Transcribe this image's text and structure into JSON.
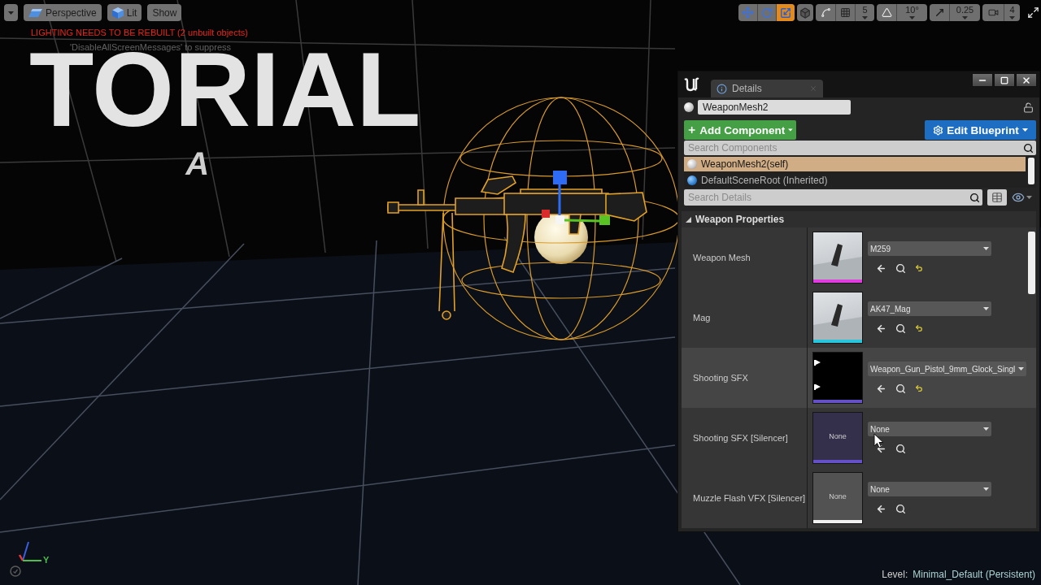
{
  "viewport": {
    "view_buttons": [
      "Perspective",
      "Lit",
      "Show"
    ],
    "warning": "LIGHTING NEEDS TO BE REBUILT (2 unbuilt objects)",
    "hint": "'DisableAllScreenMessages' to suppress",
    "scene_texts": [
      "TORIAL",
      "A"
    ],
    "transform_tools": [
      {
        "selected": false
      },
      {
        "selected": false
      },
      {
        "selected": true
      }
    ],
    "grid_snap": "5",
    "rotation_snap": "10°",
    "scale_snap": "0.25",
    "camera_speed": "4",
    "axis_label": "Y",
    "level_label": "Level:",
    "level_name": "Minimal_Default (Persistent)"
  },
  "details": {
    "tab": "Details",
    "actor_name": "WeaponMesh2",
    "add_component": "Add Component",
    "edit_blueprint": "Edit Blueprint",
    "search_components": {
      "placeholder": "Search Components"
    },
    "components": [
      {
        "label": "WeaponMesh2(self)",
        "selected": true
      },
      {
        "label": "DefaultSceneRoot (Inherited)",
        "selected": false
      }
    ],
    "search_details": {
      "placeholder": "Search Details"
    },
    "category": {
      "label": "Weapon Properties",
      "expanded": true
    },
    "properties": [
      {
        "label": "Weapon Mesh",
        "kind": "mesh",
        "value": "M259",
        "color": "#e03ce0",
        "modified": true,
        "hovered": false
      },
      {
        "label": "Mag",
        "kind": "mesh",
        "value": "AK47_Mag",
        "color": "#27c6dc",
        "modified": true,
        "hovered": false
      },
      {
        "label": "Shooting SFX",
        "kind": "sound",
        "value": "Weapon_Gun_Pistol_9mm_Glock_Singl",
        "color": "#6650c8",
        "modified": true,
        "hovered": true
      },
      {
        "label": "Shooting SFX [Silencer]",
        "kind": "empty",
        "thumbnail_text": "None",
        "value": "None",
        "color": "#6650c8",
        "modified": false,
        "hovered": false
      },
      {
        "label": "Muzzle Flash VFX [Silencer]",
        "kind": "empty",
        "thumbnail_text": "None",
        "value": "None",
        "color": "#f0f0f0",
        "modified": false,
        "hovered": false
      }
    ]
  }
}
